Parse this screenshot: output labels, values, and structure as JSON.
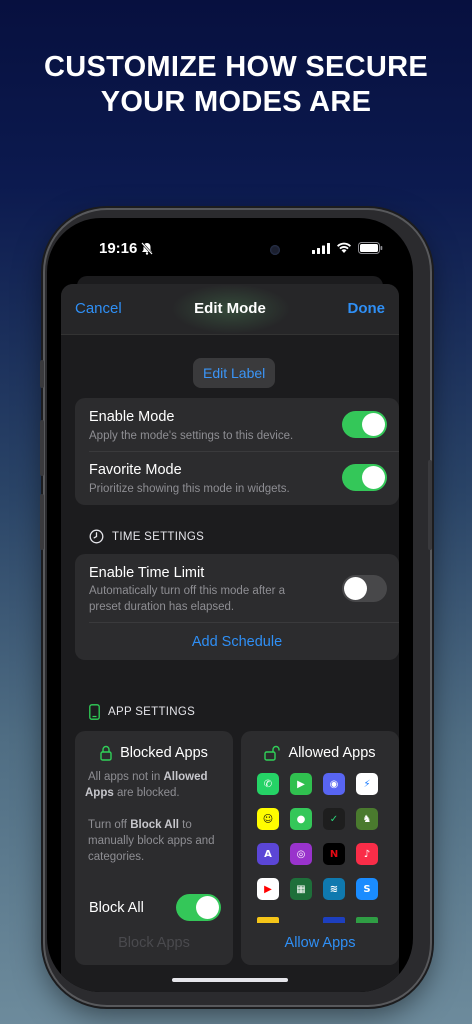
{
  "headline": {
    "line1": "CUSTOMIZE HOW SECURE",
    "line2": "YOUR MODES ARE"
  },
  "status": {
    "time": "19:16"
  },
  "nav": {
    "cancel": "Cancel",
    "title": "Edit Mode",
    "done": "Done"
  },
  "edit_label": "Edit Label",
  "mode_settings": {
    "enable": {
      "title": "Enable Mode",
      "subtitle": "Apply the mode's settings to this device.",
      "on": true
    },
    "favorite": {
      "title": "Favorite Mode",
      "subtitle": "Prioritize showing this mode in widgets.",
      "on": true
    }
  },
  "time_settings": {
    "header": "TIME SETTINGS",
    "limit_title": "Enable Time Limit",
    "limit_sub1": "Automatically turn off this mode after a",
    "limit_sub2": "preset duration has elapsed.",
    "limit_on": false,
    "add_schedule": "Add Schedule"
  },
  "app_settings": {
    "header": "APP SETTINGS",
    "blocked": {
      "title": "Blocked Apps",
      "p1a": "All apps not in ",
      "p1b": "Allowed",
      "p1c": " Apps",
      "p1d": " are blocked.",
      "p2a": "Turn off ",
      "p2b": "Block All",
      "p2c": " to manually block apps and categories.",
      "block_all": "Block All",
      "block_all_on": true,
      "block_apps": "Block Apps"
    },
    "allowed": {
      "title": "Allowed Apps",
      "allow_apps": "Allow Apps",
      "apps": [
        {
          "name": "whatsapp",
          "color": "#25d366",
          "glyph": "✆"
        },
        {
          "name": "facetime",
          "color": "#30c04f",
          "glyph": "▶"
        },
        {
          "name": "discord",
          "color": "#5865f2",
          "glyph": "◉"
        },
        {
          "name": "messenger",
          "color": "#ffffff",
          "glyph": "⚡"
        },
        {
          "name": "snapchat",
          "color": "#fffc00",
          "glyph": "☺"
        },
        {
          "name": "messages",
          "color": "#34c759",
          "glyph": "●"
        },
        {
          "name": "robinhood",
          "color": "#1e1e1e",
          "glyph": "✓"
        },
        {
          "name": "game",
          "color": "#4a7a2e",
          "glyph": "♞"
        },
        {
          "name": "altstore",
          "color": "#5b46d6",
          "glyph": "A"
        },
        {
          "name": "podcasts",
          "color": "#9933cc",
          "glyph": "◎"
        },
        {
          "name": "netflix",
          "color": "#000000",
          "glyph": "N"
        },
        {
          "name": "music",
          "color": "#fa2d48",
          "glyph": "♪"
        },
        {
          "name": "youtube",
          "color": "#ffffff",
          "glyph": "▶"
        },
        {
          "name": "fifa",
          "color": "#1e6f3a",
          "glyph": "▦"
        },
        {
          "name": "prime-video",
          "color": "#0f79af",
          "glyph": "≋"
        },
        {
          "name": "shazam",
          "color": "#1a8cff",
          "glyph": "S"
        }
      ]
    }
  }
}
